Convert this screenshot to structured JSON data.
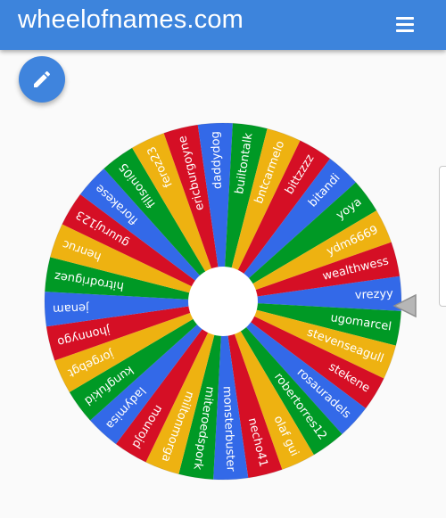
{
  "app_bar": {
    "title": "wheelofnames.com",
    "color": "#3d84dc"
  },
  "menu": {
    "icon": "hamburger-menu-icon"
  },
  "edit_button": {
    "icon": "pencil-icon",
    "color": "#3f84dd"
  },
  "wheel": {
    "names": [
      "vrezyy",
      "ugomarcel",
      "stevenseagull",
      "stekene",
      "rosauradels",
      "robertorres12",
      "olaf gui",
      "necho41",
      "monsterbuster",
      "miteroedspork",
      "miltonmorga",
      "mourojd",
      "ladymisa",
      "kungfukid",
      "jorgebgt",
      "jhonnygo",
      "jenam",
      "hitrodriguez",
      "henruc",
      "guuruj123",
      "florakese",
      "fillsoni05",
      "feroz23",
      "ericburgoyne",
      "daddydog",
      "builtontalk",
      "bntcarmelo",
      "bittzzzz",
      "bitandi",
      "yoya",
      "ydm6669",
      "wealthwess"
    ],
    "segment_colors": [
      "#3369e8",
      "#009925",
      "#eeb211",
      "#d50f25"
    ],
    "pointer_icon": "pointer-triangle-icon"
  }
}
